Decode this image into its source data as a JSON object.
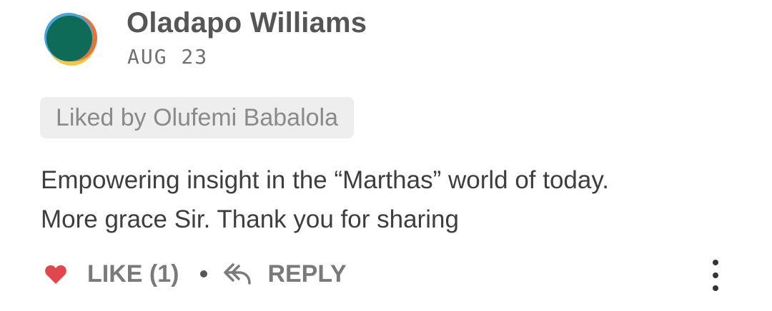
{
  "comment": {
    "author": "Oladapo Williams",
    "date": "AUG 23",
    "liked_by": "Liked by Olufemi Babalola",
    "body_lines": [
      "Empowering insight in the “Marthas” world of today.",
      "More grace Sir. Thank you for sharing"
    ]
  },
  "actions": {
    "like_label": "LIKE (1)",
    "reply_label": "REPLY",
    "like_icon": "heart-icon",
    "reply_icon": "reply-arrow-icon",
    "more_icon": "more-vertical-icon"
  },
  "colors": {
    "heart": "#e0474c",
    "avatar_green": "#0e6b57",
    "avatar_orange": "#e8733a",
    "avatar_yellow": "#f3c74b",
    "avatar_blue": "#4aa6d8"
  }
}
